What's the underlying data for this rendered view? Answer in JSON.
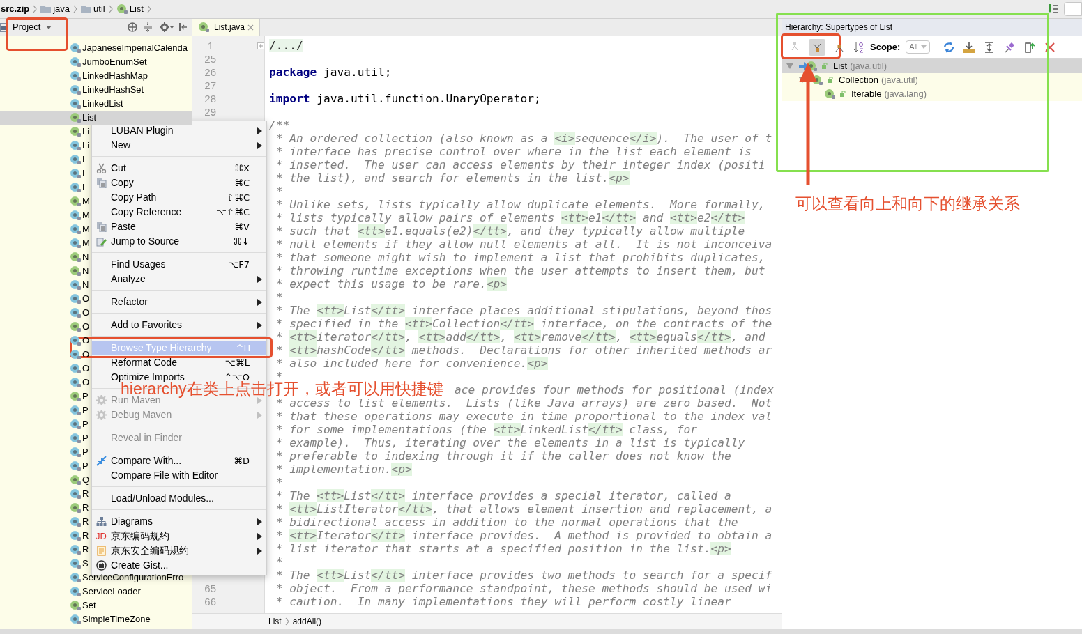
{
  "breadcrumb": [
    {
      "label": "src.zip",
      "kind": "archive"
    },
    {
      "label": "java",
      "kind": "folder"
    },
    {
      "label": "util",
      "kind": "folder"
    },
    {
      "label": "List",
      "kind": "interface"
    }
  ],
  "project_panel": {
    "title": "Project",
    "items": [
      {
        "label": "JapaneseImperialCalenda",
        "kind": "class",
        "selected": false
      },
      {
        "label": "JumboEnumSet",
        "kind": "class",
        "selected": false
      },
      {
        "label": "LinkedHashMap",
        "kind": "class",
        "selected": false
      },
      {
        "label": "LinkedHashSet",
        "kind": "class",
        "selected": false
      },
      {
        "label": "LinkedList",
        "kind": "class",
        "selected": false
      },
      {
        "label": "List",
        "kind": "interface",
        "selected": true
      },
      {
        "label": "Li",
        "kind": "interface",
        "selected": false
      },
      {
        "label": "Li",
        "kind": "class",
        "selected": false
      },
      {
        "label": "L",
        "kind": "class",
        "selected": false
      },
      {
        "label": "L",
        "kind": "class",
        "selected": false
      },
      {
        "label": "L",
        "kind": "class",
        "selected": false
      },
      {
        "label": "M",
        "kind": "interface",
        "selected": false
      },
      {
        "label": "M",
        "kind": "class",
        "selected": false
      },
      {
        "label": "M",
        "kind": "class",
        "selected": false
      },
      {
        "label": "M",
        "kind": "class",
        "selected": false
      },
      {
        "label": "N",
        "kind": "interface",
        "selected": false
      },
      {
        "label": "N",
        "kind": "interface",
        "selected": false
      },
      {
        "label": "N",
        "kind": "class",
        "selected": false
      },
      {
        "label": "O",
        "kind": "class",
        "selected": false
      },
      {
        "label": "O",
        "kind": "class",
        "selected": false
      },
      {
        "label": "O",
        "kind": "interface",
        "selected": false
      },
      {
        "label": "O",
        "kind": "class",
        "selected": false
      },
      {
        "label": "O",
        "kind": "class",
        "selected": false
      },
      {
        "label": "O",
        "kind": "class",
        "selected": false
      },
      {
        "label": "O",
        "kind": "class",
        "selected": false
      },
      {
        "label": "P",
        "kind": "interface",
        "selected": false
      },
      {
        "label": "P",
        "kind": "class",
        "selected": false
      },
      {
        "label": "P",
        "kind": "class",
        "selected": false
      },
      {
        "label": "P",
        "kind": "class",
        "selected": false
      },
      {
        "label": "P",
        "kind": "class",
        "selected": false
      },
      {
        "label": "P",
        "kind": "class",
        "selected": false
      },
      {
        "label": "Q",
        "kind": "interface",
        "selected": false
      },
      {
        "label": "R",
        "kind": "class",
        "selected": false
      },
      {
        "label": "R",
        "kind": "interface",
        "selected": false
      },
      {
        "label": "R",
        "kind": "class",
        "selected": false
      },
      {
        "label": "R",
        "kind": "class",
        "selected": false
      },
      {
        "label": "R",
        "kind": "class",
        "selected": false
      },
      {
        "label": "S",
        "kind": "class",
        "selected": false
      },
      {
        "label": "ServiceConfigurationErro",
        "kind": "class",
        "selected": false
      },
      {
        "label": "ServiceLoader",
        "kind": "class",
        "selected": false
      },
      {
        "label": "Set",
        "kind": "interface",
        "selected": false
      },
      {
        "label": "SimpleTimeZone",
        "kind": "class",
        "selected": false
      }
    ]
  },
  "editor": {
    "tabs": [
      {
        "label": "List.java",
        "selected": true
      }
    ],
    "lines": [
      {
        "number": "1",
        "kind": "fold",
        "text": "/.../"
      },
      {
        "number": "25",
        "kind": "blank"
      },
      {
        "number": "26",
        "kind": "decl",
        "keyword": "package",
        "text": " java.util;"
      },
      {
        "number": "27",
        "kind": "blank"
      },
      {
        "number": "28",
        "kind": "decl",
        "keyword": "import",
        "text": " java.util.function.UnaryOperator;"
      },
      {
        "number": "29",
        "kind": "blank"
      },
      {
        "kind": "doc",
        "text": "/**"
      },
      {
        "kind": "doc",
        "text": " * An ordered collection (also known as a <i>sequence</i>).  The user of t"
      },
      {
        "kind": "doc",
        "text": " * interface has precise control over where in the list each element is"
      },
      {
        "kind": "doc",
        "text": " * inserted.  The user can access elements by their integer index (positi"
      },
      {
        "kind": "doc",
        "text": " * the list), and search for elements in the list.<p>"
      },
      {
        "kind": "doc",
        "text": " *"
      },
      {
        "kind": "doc",
        "text": " * Unlike sets, lists typically allow duplicate elements.  More formally,"
      },
      {
        "kind": "doc",
        "text": " * lists typically allow pairs of elements <tt>e1</tt> and <tt>e2</tt>"
      },
      {
        "kind": "doc",
        "text": " * such that <tt>e1.equals(e2)</tt>, and they typically allow multiple"
      },
      {
        "kind": "doc",
        "text": " * null elements if they allow null elements at all.  It is not inconceiva"
      },
      {
        "kind": "doc",
        "text": " * that someone might wish to implement a list that prohibits duplicates,"
      },
      {
        "kind": "doc",
        "text": " * throwing runtime exceptions when the user attempts to insert them, but"
      },
      {
        "kind": "doc",
        "text": " * expect this usage to be rare.<p>"
      },
      {
        "kind": "doc",
        "text": " *"
      },
      {
        "kind": "doc",
        "text": " * The <tt>List</tt> interface places additional stipulations, beyond thos"
      },
      {
        "kind": "doc",
        "text": " * specified in the <tt>Collection</tt> interface, on the contracts of the"
      },
      {
        "kind": "doc",
        "text": " * <tt>iterator</tt>, <tt>add</tt>, <tt>remove</tt>, <tt>equals</tt>, and"
      },
      {
        "kind": "doc",
        "text": " * <tt>hashCode</tt> methods.  Declarations for other inherited methods ar"
      },
      {
        "kind": "doc",
        "text": " * also included here for convenience.<p>"
      },
      {
        "kind": "doc",
        "text": " *"
      },
      {
        "kind": "tail",
        "text": "ace provides four methods for positional (index"
      },
      {
        "kind": "doc",
        "text": " * access to list elements.  Lists (like Java arrays) are zero based.  Not"
      },
      {
        "kind": "doc",
        "text": " * that these operations may execute in time proportional to the index val"
      },
      {
        "kind": "doc",
        "text": " * for some implementations (the <tt>LinkedList</tt> class, for"
      },
      {
        "kind": "doc",
        "text": " * example).  Thus, iterating over the elements in a list is typically"
      },
      {
        "kind": "doc",
        "text": " * preferable to indexing through it if the caller does not know the"
      },
      {
        "kind": "doc",
        "text": " * implementation.<p>"
      },
      {
        "kind": "doc",
        "text": " *"
      },
      {
        "kind": "doc",
        "text": " * The <tt>List</tt> interface provides a special iterator, called a"
      },
      {
        "kind": "doc",
        "text": " * <tt>ListIterator</tt>, that allows element insertion and replacement, a"
      },
      {
        "kind": "doc",
        "text": " * bidirectional access in addition to the normal operations that the"
      },
      {
        "kind": "doc",
        "text": " * <tt>Iterator</tt> interface provides.  A method is provided to obtain a"
      },
      {
        "kind": "doc",
        "text": " * list iterator that starts at a specified position in the list.<p>"
      },
      {
        "kind": "doc",
        "text": " *"
      },
      {
        "kind": "doc",
        "text": " * The <tt>List</tt> interface provides two methods to search for a specif"
      },
      {
        "number": "65",
        "kind": "doc",
        "text": " * object.  From a performance standpoint, these methods should be used wi"
      },
      {
        "number": "66",
        "kind": "doc",
        "text": " * caution.  In many implementations they will perform costly linear"
      }
    ],
    "path": [
      "List",
      "addAll()"
    ]
  },
  "context_menu": {
    "groups": [
      [
        {
          "label": "LUBAN Plugin",
          "submenu": true,
          "disabled": false,
          "selected": false
        },
        {
          "label": "New",
          "submenu": true,
          "disabled": false,
          "selected": false
        }
      ],
      [
        {
          "label": "Cut",
          "shortcut": "⌘X",
          "submenu": false,
          "disabled": false,
          "selected": false
        },
        {
          "label": "Copy",
          "shortcut": "⌘C",
          "submenu": false,
          "disabled": false,
          "selected": false
        },
        {
          "label": "Copy Path",
          "shortcut": "⇧⌘C",
          "submenu": false,
          "disabled": false,
          "selected": false
        },
        {
          "label": "Copy Reference",
          "shortcut": "⌥⇧⌘C",
          "submenu": false,
          "disabled": false,
          "selected": false
        },
        {
          "label": "Paste",
          "shortcut": "⌘V",
          "submenu": false,
          "disabled": false,
          "selected": false
        },
        {
          "label": "Jump to Source",
          "shortcut": "⌘↓",
          "submenu": false,
          "disabled": false,
          "selected": false
        }
      ],
      [
        {
          "label": "Find Usages",
          "shortcut": "⌥F7",
          "submenu": false,
          "disabled": false,
          "selected": false
        },
        {
          "label": "Analyze",
          "submenu": true,
          "disabled": false,
          "selected": false
        }
      ],
      [
        {
          "label": "Refactor",
          "submenu": true,
          "disabled": false,
          "selected": false
        }
      ],
      [
        {
          "label": "Add to Favorites",
          "submenu": true,
          "disabled": false,
          "selected": false
        }
      ],
      [
        {
          "label": "Browse Type Hierarchy",
          "shortcut": "^H",
          "submenu": false,
          "disabled": false,
          "selected": true
        },
        {
          "label": "Reformat Code",
          "shortcut": "⌥⌘L",
          "submenu": false,
          "disabled": false,
          "selected": false
        },
        {
          "label": "Optimize Imports",
          "shortcut": "^⌥O",
          "submenu": false,
          "disabled": false,
          "selected": false
        }
      ],
      [
        {
          "label": "Run Maven",
          "submenu": true,
          "disabled": true,
          "selected": false
        },
        {
          "label": "Debug Maven",
          "submenu": true,
          "disabled": true,
          "selected": false
        }
      ],
      [
        {
          "label": "Reveal in Finder",
          "submenu": false,
          "disabled": true,
          "selected": false
        }
      ],
      [
        {
          "label": "Compare With...",
          "shortcut": "⌘D",
          "submenu": false,
          "disabled": false,
          "selected": false
        },
        {
          "label": "Compare File with Editor",
          "submenu": false,
          "disabled": false,
          "selected": false
        }
      ],
      [
        {
          "label": "Load/Unload Modules...",
          "submenu": false,
          "disabled": false,
          "selected": false
        }
      ],
      [
        {
          "label": "Diagrams",
          "submenu": true,
          "disabled": false,
          "selected": false
        },
        {
          "label": "京东编码规约",
          "badge": "JD",
          "submenu": true,
          "disabled": false,
          "selected": false
        },
        {
          "label": "京东安全编码规约",
          "submenu": true,
          "disabled": false,
          "selected": false
        },
        {
          "label": "Create Gist...",
          "submenu": false,
          "disabled": false,
          "selected": false
        }
      ]
    ]
  },
  "hierarchy": {
    "title": "Hierarchy: Supertypes of List",
    "view_buttons": [
      {
        "selected": false
      },
      {
        "selected": true
      },
      {
        "selected": false
      }
    ],
    "scope_label": "Scope:",
    "scope_value": "All",
    "tree": [
      {
        "name": "List",
        "package": "(java.util)",
        "selected": true,
        "expanded": true,
        "children": [
          {
            "name": "Collection",
            "package": "(java.util)",
            "selected": false,
            "expanded": true,
            "children": [
              {
                "name": "Iterable",
                "package": "(java.lang)",
                "selected": false
              }
            ]
          }
        ]
      }
    ]
  },
  "annotations": [
    {
      "text": "hierarchy在类上点击打开，或者可以用快捷键"
    },
    {
      "text": "可以查看向上和向下的继承关系"
    }
  ]
}
